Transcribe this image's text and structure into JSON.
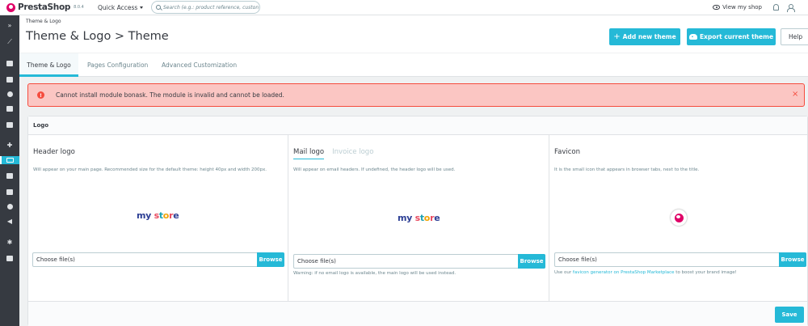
{
  "topbar": {
    "brand": "PrestaShop",
    "version": "8.0.4",
    "quick_access": "Quick Access",
    "search_placeholder": "Search (e.g.: product reference, custon",
    "view_shop": "View my shop"
  },
  "sidebar": {
    "toggle": "»",
    "active_item": "design"
  },
  "header": {
    "breadcrumb": "Theme & Logo",
    "title": "Theme & Logo > Theme",
    "add_theme": "Add new theme",
    "export_theme": "Export current theme",
    "help": "Help"
  },
  "tabs": [
    {
      "label": "Theme & Logo",
      "active": true
    },
    {
      "label": "Pages Configuration",
      "active": false
    },
    {
      "label": "Advanced Customization",
      "active": false
    }
  ],
  "alert": {
    "icon": "!",
    "message": "Cannot install module bonask. The module is invalid and cannot be loaded.",
    "close": "×"
  },
  "logo_card": {
    "title": "Logo",
    "header_logo": {
      "title": "Header logo",
      "description": "Will appear on your main page. Recommended size for the default theme: height 40px and width 200px.",
      "file_placeholder": "Choose file(s)",
      "browse": "Browse"
    },
    "mail_logo": {
      "tab_mail": "Mail logo",
      "tab_invoice": "Invoice logo",
      "description": "Will appear on email headers. If undefined, the header logo will be used.",
      "file_placeholder": "Choose file(s)",
      "browse": "Browse",
      "warning": "Warning: if no email logo is available, the main logo will be used instead."
    },
    "favicon": {
      "title": "Favicon",
      "description": "It is the small icon that appears in browser tabs, next to the title.",
      "file_placeholder": "Choose file(s)",
      "browse": "Browse",
      "help_prefix": "Use our",
      "help_link": "favicon generator on PrestaShop Marketplace",
      "help_suffix": "to boost your brand image!"
    },
    "store_logo": {
      "my": "my",
      "store": [
        "s",
        "t",
        "o",
        "r",
        "e"
      ]
    },
    "save": "Save"
  },
  "colors": {
    "primary": "#25b9d7",
    "sidebar": "#363a41",
    "alert_bg": "#fbc6c3",
    "alert_border": "#f54c3e"
  }
}
